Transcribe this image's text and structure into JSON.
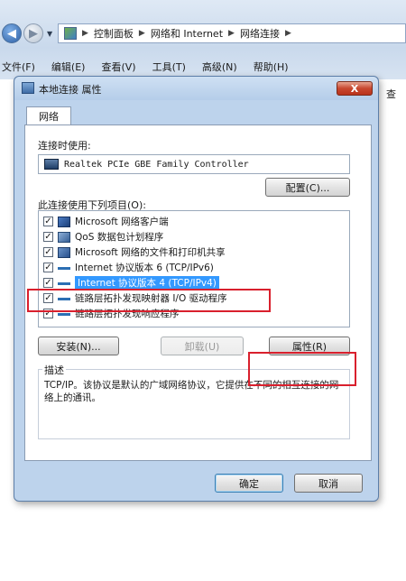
{
  "explorer": {
    "breadcrumbs": [
      "控制面板",
      "网络和 Internet",
      "网络连接"
    ],
    "menu": [
      "文件(F)",
      "编辑(E)",
      "查看(V)",
      "工具(T)",
      "高级(N)",
      "帮助(H)"
    ],
    "right_panel_text": "查"
  },
  "dialog": {
    "title": "本地连接 属性",
    "close_label": "X",
    "tab_label": "网络",
    "connect_using_label": "连接时使用:",
    "adapter_name": "Realtek PCIe GBE Family Controller",
    "configure_button": "配置(C)...",
    "items_label": "此连接使用下列项目(O):",
    "items": [
      {
        "label": "Microsoft 网络客户端",
        "checked": true,
        "icon": "network-client-icon"
      },
      {
        "label": "QoS 数据包计划程序",
        "checked": true,
        "icon": "qos-icon"
      },
      {
        "label": "Microsoft 网络的文件和打印机共享",
        "checked": true,
        "icon": "file-printer-sharing-icon"
      },
      {
        "label": "Internet 协议版本 6 (TCP/IPv6)",
        "checked": true,
        "icon": "protocol-icon"
      },
      {
        "label": "Internet 协议版本 4 (TCP/IPv4)",
        "checked": true,
        "icon": "protocol-icon",
        "selected": true
      },
      {
        "label": "链路层拓扑发现映射器 I/O 驱动程序",
        "checked": true,
        "icon": "protocol-icon"
      },
      {
        "label": "链路层拓扑发现响应程序",
        "checked": true,
        "icon": "protocol-icon"
      }
    ],
    "install_button": "安装(N)...",
    "uninstall_button": "卸载(U)",
    "properties_button": "属性(R)",
    "description_label": "描述",
    "description_text": "TCP/IP。该协议是默认的广域网络协议，它提供在不同的相互连接的网络上的通讯。",
    "ok_button": "确定",
    "cancel_button": "取消"
  },
  "colors": {
    "selection": "#3399ff",
    "annotation_highlight": "#d9202d"
  }
}
